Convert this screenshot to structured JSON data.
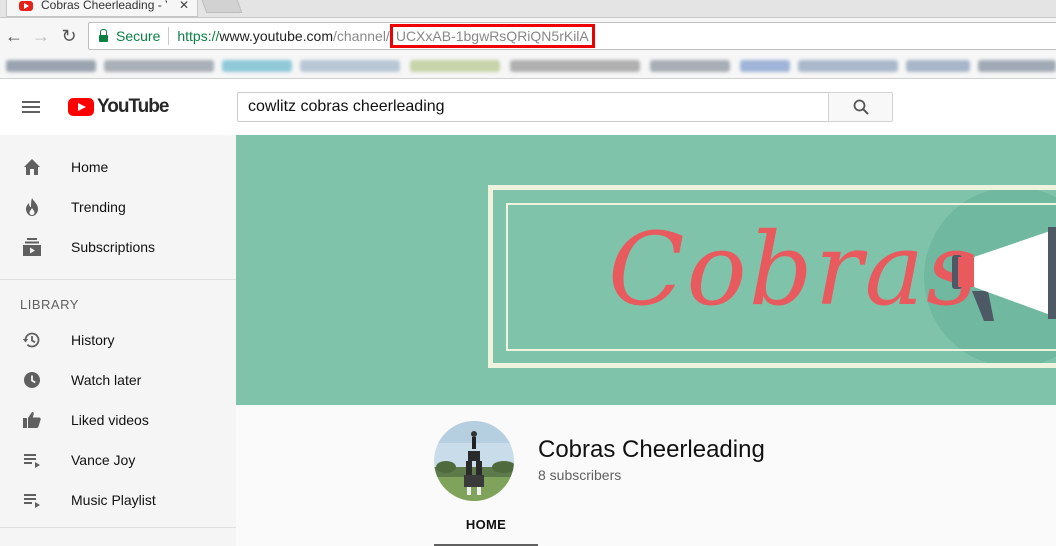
{
  "browser": {
    "tab_title": "Cobras Cheerleading - Yo",
    "tab_close": "✕",
    "secure_label": "Secure",
    "url_scheme": "https://",
    "url_host": "www.youtube.com",
    "url_path": "/channel/",
    "url_channel_id": "UCXxAB-1bgwRsQRiQN5rKilA",
    "back_icon": "←",
    "forward_icon": "→",
    "reload_icon": "↻"
  },
  "masthead": {
    "logo_text": "YouTube",
    "search_value": "cowlitz cobras cheerleading"
  },
  "sidebar": {
    "main": [
      {
        "label": "Home",
        "icon": "home-icon"
      },
      {
        "label": "Trending",
        "icon": "flame-icon"
      },
      {
        "label": "Subscriptions",
        "icon": "subscriptions-icon"
      }
    ],
    "library_heading": "LIBRARY",
    "library": [
      {
        "label": "History",
        "icon": "history-icon"
      },
      {
        "label": "Watch later",
        "icon": "clock-icon"
      },
      {
        "label": "Liked videos",
        "icon": "thumbs-up-icon"
      },
      {
        "label": "Vance Joy",
        "icon": "playlist-icon"
      },
      {
        "label": "Music Playlist",
        "icon": "playlist-icon"
      }
    ]
  },
  "banner": {
    "text": "Cobras"
  },
  "channel": {
    "name": "Cobras Cheerleading",
    "subscribers": "8 subscribers",
    "active_tab": "HOME"
  },
  "colors": {
    "brand_red": "#ff0000",
    "banner_bg": "#7fc4aa",
    "banner_text": "#e85a5e",
    "secure_green": "#0b8043",
    "highlight_box": "#ee0000"
  }
}
